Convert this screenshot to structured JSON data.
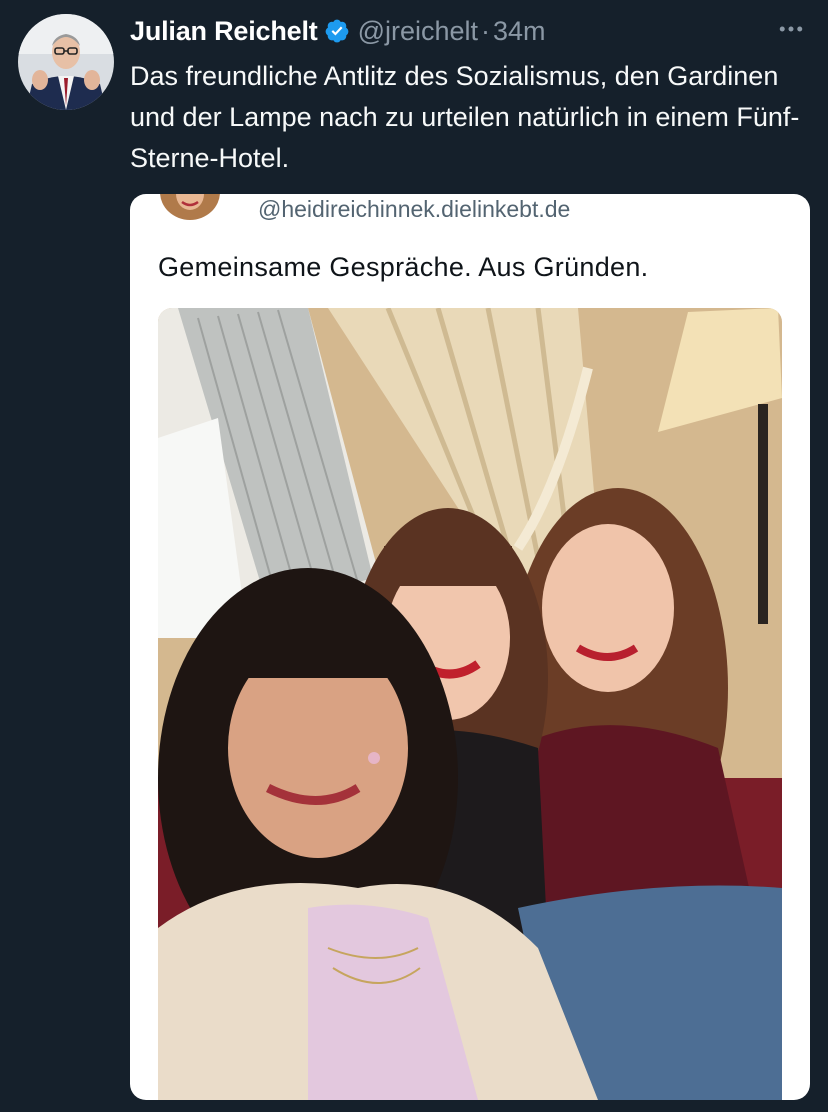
{
  "tweet": {
    "author_name": "Julian Reichelt",
    "handle": "@jreichelt",
    "separator": "·",
    "timestamp": "34m",
    "text": "Das freundliche Antlitz des Sozialismus, den Gardinen und der Lampe nach zu urteilen natürlich in einem Fünf-Sterne-Hotel.",
    "verified_color": "#1d9bf0",
    "more_icon": "more-horizontal-icon"
  },
  "quoted": {
    "handle": "@heidireichinnek.dielinkebt.de",
    "text": "Gemeinsame Gespräche. Aus Gründen."
  },
  "theme": {
    "background": "#15202b",
    "primary_text": "#f7f9f9",
    "secondary_text": "#8b98a5"
  }
}
